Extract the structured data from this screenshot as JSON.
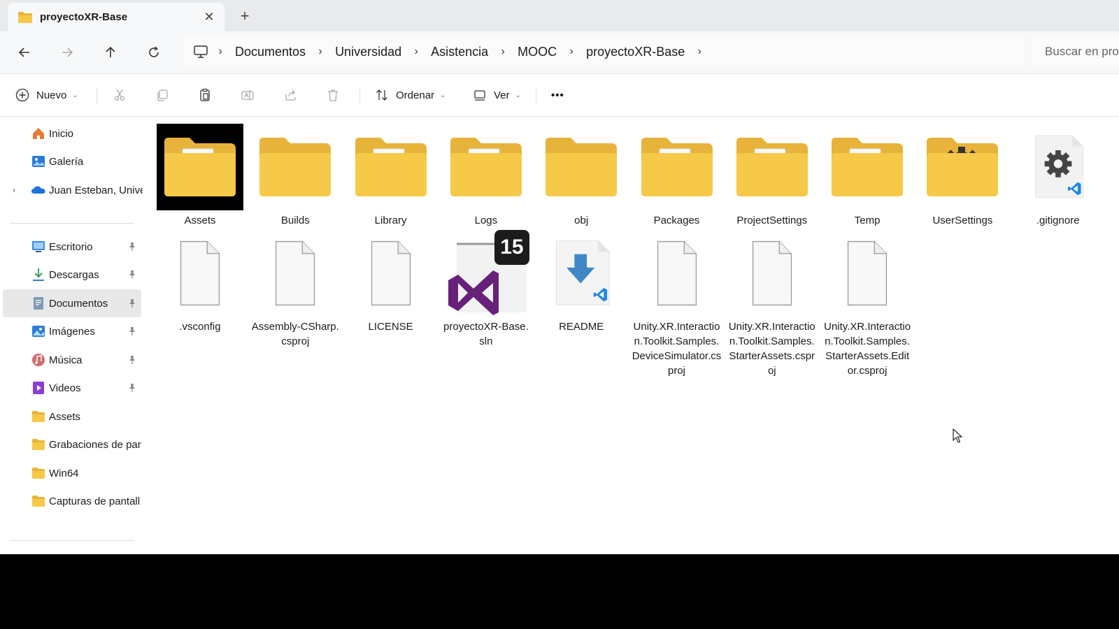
{
  "tab": {
    "title": "proyectoXR-Base",
    "close": "✕",
    "new_tab": "+"
  },
  "breadcrumb": [
    "Documentos",
    "Universidad",
    "Asistencia",
    "MOOC",
    "proyectoXR-Base"
  ],
  "search": {
    "placeholder": "Buscar en pro"
  },
  "commands": {
    "new_label": "Nuevo",
    "sort_label": "Ordenar",
    "view_label": "Ver",
    "more_label": "•••"
  },
  "sidebar": {
    "items": [
      {
        "label": "Inicio",
        "icon": "home-icon"
      },
      {
        "label": "Galería",
        "icon": "gallery-icon"
      },
      {
        "label": "Juan Esteban, Unive",
        "icon": "onedrive-cloud-icon"
      },
      {
        "label": "Escritorio",
        "icon": "desktop-icon",
        "pinned": true
      },
      {
        "label": "Descargas",
        "icon": "downloads-icon",
        "pinned": true
      },
      {
        "label": "Documentos",
        "icon": "documents-icon",
        "pinned": true,
        "selected": true
      },
      {
        "label": "Imágenes",
        "icon": "pictures-icon",
        "pinned": true
      },
      {
        "label": "Música",
        "icon": "music-icon",
        "pinned": true
      },
      {
        "label": "Videos",
        "icon": "videos-icon",
        "pinned": true
      },
      {
        "label": "Assets",
        "icon": "folder-icon"
      },
      {
        "label": "Grabaciones de par",
        "icon": "folder-icon"
      },
      {
        "label": "Win64",
        "icon": "folder-icon"
      },
      {
        "label": "Capturas de pantall",
        "icon": "folder-icon"
      }
    ]
  },
  "files": [
    {
      "name": "Assets",
      "type": "folder-doc",
      "selected": true
    },
    {
      "name": "Builds",
      "type": "folder-empty"
    },
    {
      "name": "Library",
      "type": "folder-doc"
    },
    {
      "name": "Logs",
      "type": "folder-doc"
    },
    {
      "name": "obj",
      "type": "folder-empty"
    },
    {
      "name": "Packages",
      "type": "folder-doc"
    },
    {
      "name": "ProjectSettings",
      "type": "folder-doc"
    },
    {
      "name": "Temp",
      "type": "folder-doc"
    },
    {
      "name": "UserSettings",
      "type": "folder-gear"
    },
    {
      "name": ".gitignore",
      "type": "gitignore-file"
    },
    {
      "name": ".vsconfig",
      "type": "blank-file"
    },
    {
      "name": "Assembly-CSharp.csproj",
      "type": "blank-file"
    },
    {
      "name": "LICENSE",
      "type": "blank-file"
    },
    {
      "name": "proyectoXR-Base.sln",
      "type": "vs-solution-file",
      "badge": "15"
    },
    {
      "name": "README",
      "type": "readme-file"
    },
    {
      "name": "Unity.XR.Interaction.Toolkit.Samples.DeviceSimulator.csproj",
      "type": "blank-file"
    },
    {
      "name": "Unity.XR.Interaction.Toolkit.Samples.StarterAssets.csproj",
      "type": "blank-file"
    },
    {
      "name": "Unity.XR.Interaction.Toolkit.Samples.StarterAssets.Editor.csproj",
      "type": "blank-file"
    }
  ],
  "colors": {
    "folder": "#f7c948",
    "folder_back": "#e8b33a",
    "vs_purple": "#68217a",
    "vscode_blue": "#1e88e5",
    "readme_arrow": "#3f88c5",
    "selected_nav": "#e8e8e8"
  }
}
